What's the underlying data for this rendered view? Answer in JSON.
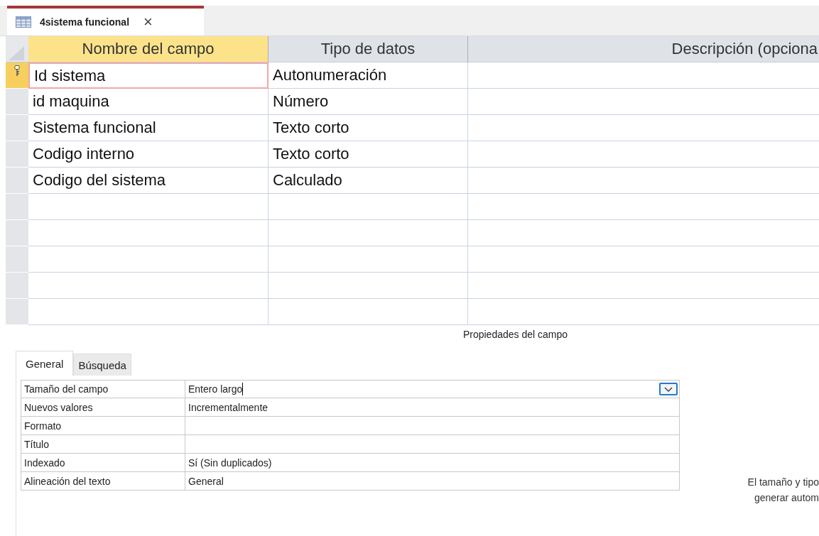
{
  "document_tab": {
    "title": "4sistema funcional",
    "close": "×",
    "selected": true
  },
  "grid": {
    "columns": [
      {
        "label": "Nombre del campo",
        "selected": true
      },
      {
        "label": "Tipo de datos",
        "selected": false
      },
      {
        "label": "Descripción (opciona",
        "selected": false
      }
    ],
    "rows": [
      {
        "field_name": "Id sistema",
        "data_type": "Autonumeración",
        "primary_key": true,
        "selected": true
      },
      {
        "field_name": "id maquina",
        "data_type": "Número",
        "primary_key": false,
        "selected": false
      },
      {
        "field_name": "Sistema funcional",
        "data_type": "Texto corto",
        "primary_key": false,
        "selected": false
      },
      {
        "field_name": "Codigo interno",
        "data_type": "Texto corto",
        "primary_key": false,
        "selected": false
      },
      {
        "field_name": "Codigo del sistema",
        "data_type": "Calculado",
        "primary_key": false,
        "selected": false
      }
    ]
  },
  "field_properties": {
    "title": "Propiedades del campo",
    "tabs": [
      {
        "label": "General",
        "selected": true
      },
      {
        "label": "Búsqueda",
        "selected": false
      }
    ],
    "properties": [
      {
        "name": "Tamaño del campo",
        "value": "Entero largo",
        "focused": true
      },
      {
        "name": "Nuevos valores",
        "value": "Incrementalmente",
        "focused": false
      },
      {
        "name": "Formato",
        "focused": false
      },
      {
        "name": "Título",
        "focused": false
      },
      {
        "name": "Indexado",
        "value": "Sí (Sin duplicados)",
        "focused": false
      },
      {
        "name": "Alineación del texto",
        "value": "General",
        "focused": false
      }
    ],
    "help_lines": [
      "El tamaño y tipo",
      "generar autom"
    ]
  }
}
